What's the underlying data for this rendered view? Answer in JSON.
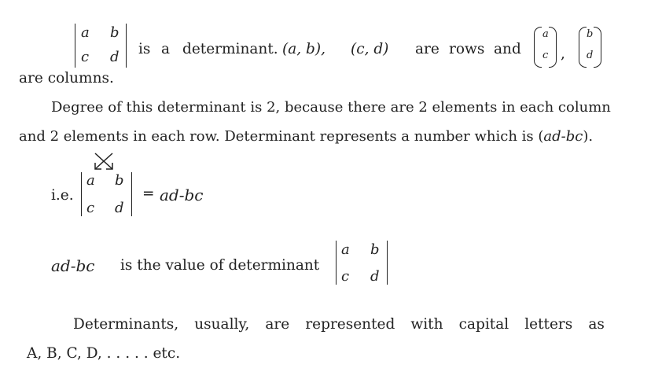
{
  "determinant": {
    "a": "a",
    "b": "b",
    "c": "c",
    "d": "d"
  },
  "line1": {
    "w1": "is",
    "w2": "a",
    "w3": "determinant.",
    "row1": "(a,  b),",
    "row2": "(c,  d)",
    "w4": "are",
    "w5": "rows",
    "w6": "and",
    "comma": ","
  },
  "line2": "are columns.",
  "para2": {
    "line1": "Degree of this determinant is 2, because there are 2 elements in each column",
    "line2_text": "and 2 elements in each row. Determinant represents a number which is (",
    "line2_expr": "ad-bc",
    "line2_end": ")."
  },
  "ie": {
    "label": "i.e.",
    "equals": "=",
    "expr": "ad-bc"
  },
  "value_line": {
    "expr": "ad-bc",
    "text": "is the value of determinant"
  },
  "para3": {
    "words": [
      "Determinants,",
      "usually,",
      "are",
      "represented",
      "with",
      "capital",
      "letters",
      "as"
    ],
    "line2": "A, B, C, D, . . . . . etc."
  }
}
